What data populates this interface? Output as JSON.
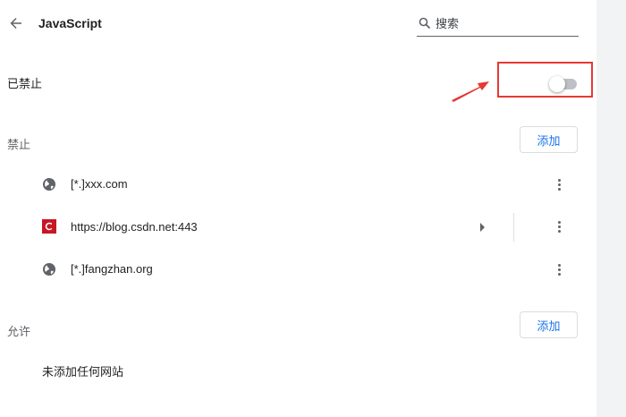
{
  "header": {
    "title": "JavaScript",
    "search_placeholder": "搜索"
  },
  "main_setting": {
    "label": "已禁止",
    "toggle_on": false
  },
  "blocked": {
    "label": "禁止",
    "add_label": "添加",
    "items": [
      {
        "text": "[*.]xxx.com",
        "icon": "globe-icon"
      },
      {
        "text": "https://blog.csdn.net:443",
        "icon": "csdn-favicon"
      },
      {
        "text": "[*.]fangzhan.org",
        "icon": "globe-icon"
      }
    ]
  },
  "allowed": {
    "label": "允许",
    "add_label": "添加",
    "empty_text": "未添加任何网站"
  },
  "colors": {
    "accent": "#1a73e8",
    "highlight": "#e53935",
    "csdn": "#c81623"
  }
}
